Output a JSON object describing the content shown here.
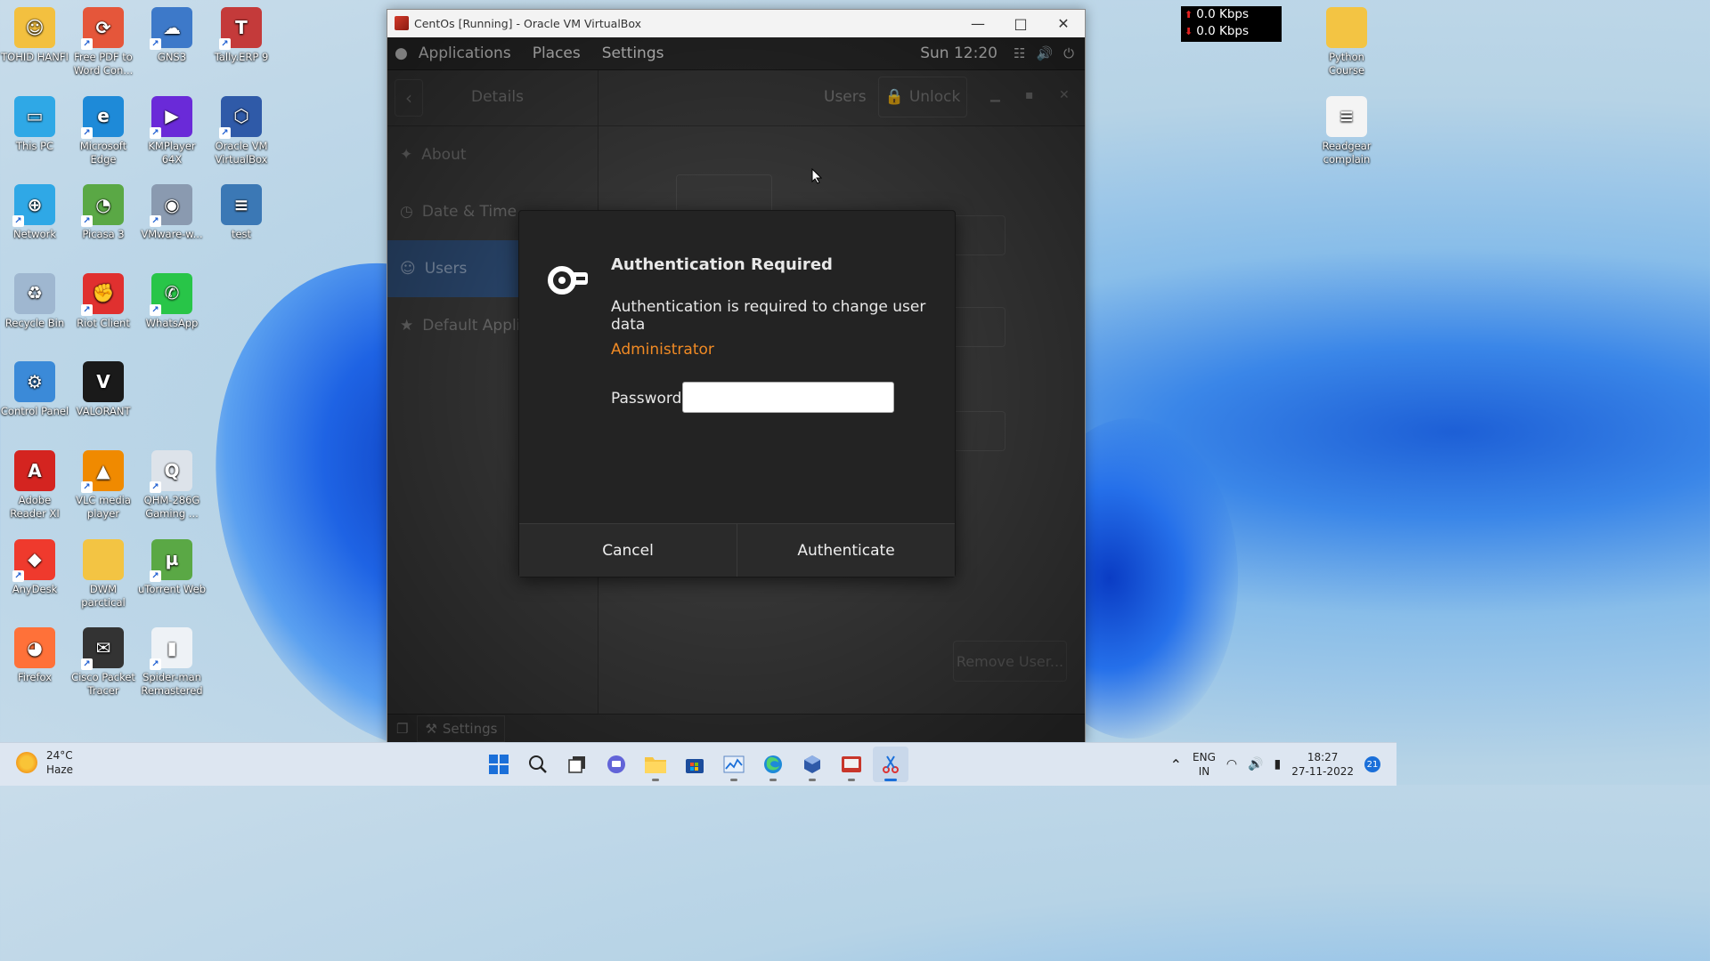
{
  "desktop": {
    "icons_left": [
      {
        "label": "TOHID HANFI",
        "icon": "user-folder-icon"
      },
      {
        "label": "Free PDF to Word Con...",
        "icon": "pdf-converter-icon"
      },
      {
        "label": "GNS3",
        "icon": "gns3-icon"
      },
      {
        "label": "Tally.ERP 9",
        "icon": "tally-icon"
      },
      {
        "label": "This PC",
        "icon": "computer-icon"
      },
      {
        "label": "Microsoft Edge",
        "icon": "edge-icon"
      },
      {
        "label": "KMPlayer 64X",
        "icon": "kmplayer-icon"
      },
      {
        "label": "Oracle VM VirtualBox",
        "icon": "virtualbox-icon"
      },
      {
        "label": "Network",
        "icon": "network-icon"
      },
      {
        "label": "Picasa 3",
        "icon": "picasa-icon"
      },
      {
        "label": "VMware-w...",
        "icon": "vmware-icon"
      },
      {
        "label": "test",
        "icon": "python-file-icon"
      },
      {
        "label": "Recycle Bin",
        "icon": "recycle-bin-icon"
      },
      {
        "label": "Riot Client",
        "icon": "riot-client-icon"
      },
      {
        "label": "WhatsApp",
        "icon": "whatsapp-icon"
      },
      {
        "label": "Control Panel",
        "icon": "control-panel-icon"
      },
      {
        "label": "VALORANT",
        "icon": "valorant-icon"
      },
      {
        "label": "Adobe Reader XI",
        "icon": "adobe-reader-icon"
      },
      {
        "label": "VLC media player",
        "icon": "vlc-icon"
      },
      {
        "label": "QHM-286G Gaming ...",
        "icon": "quantum-icon"
      },
      {
        "label": "AnyDesk",
        "icon": "anydesk-icon"
      },
      {
        "label": "DWM parctical",
        "icon": "folder-icon"
      },
      {
        "label": "uTorrent Web",
        "icon": "utorrent-icon"
      },
      {
        "label": "Firefox",
        "icon": "firefox-icon"
      },
      {
        "label": "Cisco Packet Tracer",
        "icon": "packet-tracer-icon"
      },
      {
        "label": "Spider-man Remastered",
        "icon": "spiderman-icon"
      }
    ],
    "icons_right": [
      {
        "label": "Python Course",
        "icon": "folder-icon"
      },
      {
        "label": "Readgear complain",
        "icon": "text-file-icon"
      }
    ]
  },
  "netmeter": {
    "up": "0.0 Kbps",
    "down": "0.0 Kbps"
  },
  "vbox": {
    "title": "CentOs [Running] - Oracle VM VirtualBox",
    "guest": {
      "topbar": {
        "applications": "Applications",
        "places": "Places",
        "settings": "Settings",
        "clock": "Sun 12:20"
      },
      "header": {
        "details": "Details",
        "users": "Users",
        "unlock": "Unlock"
      },
      "sidebar": [
        {
          "label": "About",
          "icon": "star-icon"
        },
        {
          "label": "Date & Time",
          "icon": "clock-icon"
        },
        {
          "label": "Users",
          "icon": "users-icon"
        },
        {
          "label": "Default Applicati",
          "icon": "star-icon"
        }
      ],
      "remove_user": "Remove User...",
      "bottom_settings": "Settings"
    },
    "dialog": {
      "title": "Authentication Required",
      "message": "Authentication is required to change user data",
      "user": "Administrator",
      "password_label": "Password:",
      "password_value": "",
      "cancel": "Cancel",
      "authenticate": "Authenticate"
    }
  },
  "taskbar": {
    "weather_temp": "24°C",
    "weather_desc": "Haze",
    "lang1": "ENG",
    "lang2": "IN",
    "time": "18:27",
    "date": "27-11-2022",
    "notifications": "21"
  },
  "colors": {
    "accent_orange": "#f08a24",
    "selection_blue": "#2f4f7a",
    "dialog_bg": "#232323"
  }
}
